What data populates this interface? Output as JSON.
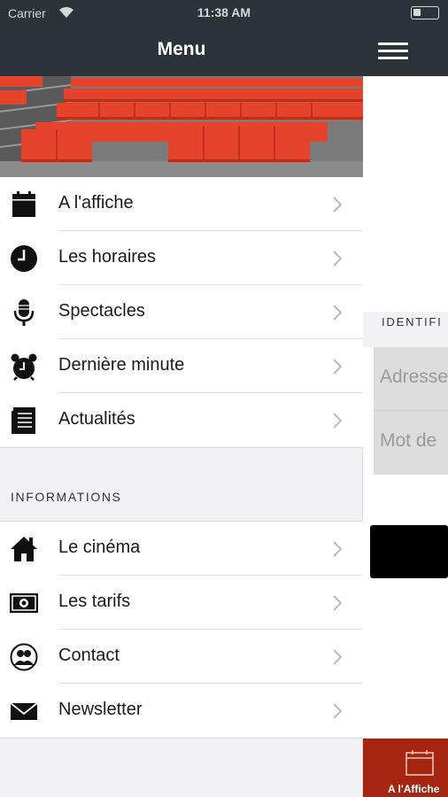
{
  "status_bar": {
    "carrier": "Carrier",
    "time": "11:38 AM"
  },
  "nav": {
    "title": "Menu"
  },
  "menu_main": [
    {
      "label": "A l'affiche",
      "icon": "calendar-icon"
    },
    {
      "label": "Les horaires",
      "icon": "clock-icon"
    },
    {
      "label": "Spectacles",
      "icon": "microphone-icon"
    },
    {
      "label": "Dernière minute",
      "icon": "alarm-clock-icon"
    },
    {
      "label": "Actualités",
      "icon": "news-icon"
    }
  ],
  "informations": {
    "header": "INFORMATIONS",
    "items": [
      {
        "label": "Le cinéma",
        "icon": "home-icon"
      },
      {
        "label": "Les tarifs",
        "icon": "banknote-icon"
      },
      {
        "label": "Contact",
        "icon": "contacts-icon"
      },
      {
        "label": "Newsletter",
        "icon": "envelope-icon"
      }
    ]
  },
  "background_page": {
    "section_header": "IDENTIFI",
    "email_placeholder": "Adresse",
    "password_placeholder": "Mot de",
    "tab_label": "A l'Affiche",
    "tab_color": "#a42611"
  },
  "colors": {
    "nav_bar": "#2c3339",
    "tab_accent": "#a42611"
  }
}
